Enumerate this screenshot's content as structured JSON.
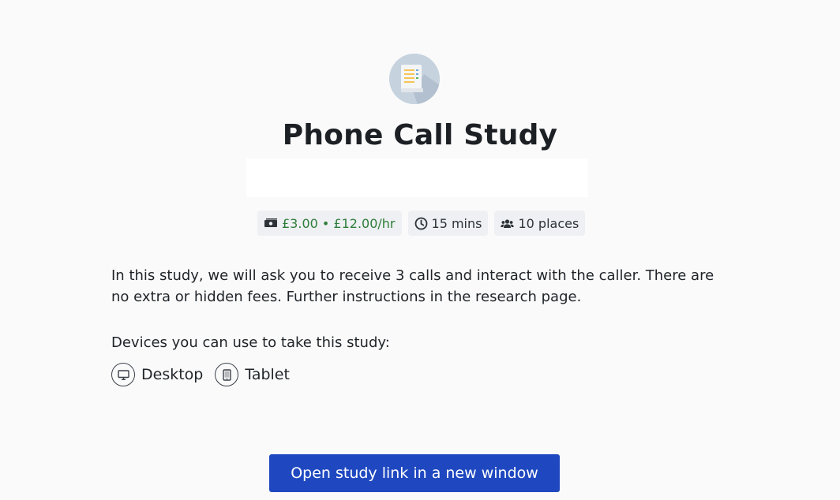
{
  "study": {
    "title": "Phone Call Study",
    "icon": "document-list-icon"
  },
  "badges": {
    "reward": "£3.00 • £12.00/hr",
    "duration": "15 mins",
    "places": "10 places"
  },
  "description": "In this study, we will ask you to receive 3 calls and interact with the caller. There are no extra or hidden fees. Further instructions in the research page.",
  "devices": {
    "heading": "Devices you can use to take this study:",
    "items": [
      {
        "label": "Desktop",
        "icon": "desktop-icon"
      },
      {
        "label": "Tablet",
        "icon": "tablet-icon"
      }
    ]
  },
  "actions": {
    "open_link_label": "Open study link in a new window"
  },
  "colors": {
    "primary_button": "#1f48c0",
    "reward_text": "#2e7d3a",
    "badge_bg": "#eef0f3",
    "page_bg": "#fafafb"
  }
}
